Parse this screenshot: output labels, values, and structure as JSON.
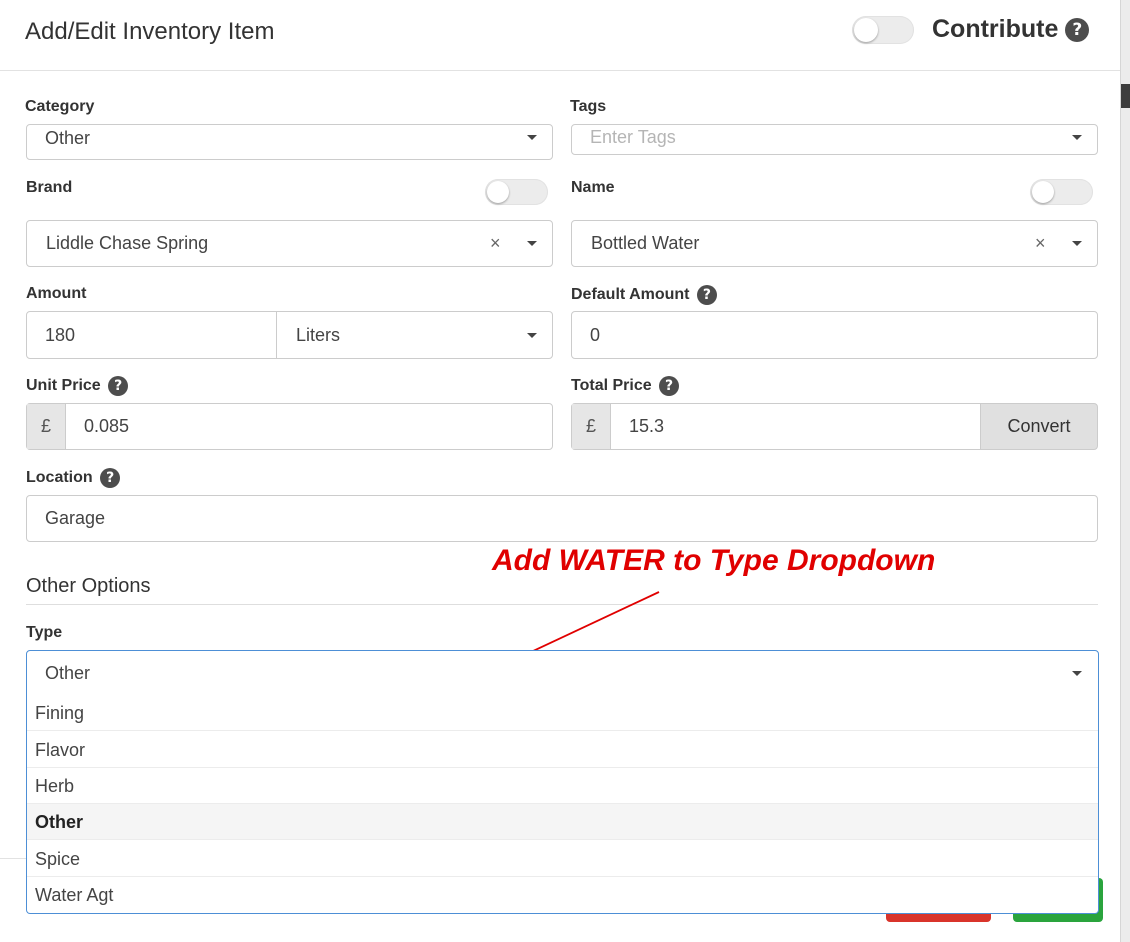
{
  "header": {
    "title": "Add/Edit Inventory Item",
    "contribute_label": "Contribute"
  },
  "help_glyph": "?",
  "form": {
    "category": {
      "label": "Category",
      "value": "Other"
    },
    "tags": {
      "label": "Tags",
      "placeholder": "Enter Tags"
    },
    "brand": {
      "label": "Brand",
      "value": "Liddle Chase Spring"
    },
    "name": {
      "label": "Name",
      "value": "Bottled Water"
    },
    "amount": {
      "label": "Amount",
      "value": "180",
      "unit": "Liters"
    },
    "default_amount": {
      "label": "Default Amount",
      "value": "0"
    },
    "unit_price": {
      "label": "Unit Price",
      "currency": "£",
      "value": "0.085"
    },
    "total_price": {
      "label": "Total Price",
      "currency": "£",
      "value": "15.3",
      "convert_label": "Convert"
    },
    "location": {
      "label": "Location",
      "value": "Garage"
    }
  },
  "other_options": {
    "title": "Other Options",
    "type": {
      "label": "Type",
      "value": "Other",
      "options": [
        "Fining",
        "Flavor",
        "Herb",
        "Other",
        "Spice",
        "Water Agt"
      ],
      "selected_index": 3
    }
  },
  "annotation": {
    "text": "Add WATER to Type Dropdown",
    "color": "#e00000"
  },
  "colors": {
    "focus_border": "#4d8fd6",
    "danger_button": "#d9342b",
    "success_button": "#2aa43d"
  },
  "icons": {
    "clear": "×",
    "help": "question-circle-icon",
    "caret": "caret-down-icon"
  }
}
